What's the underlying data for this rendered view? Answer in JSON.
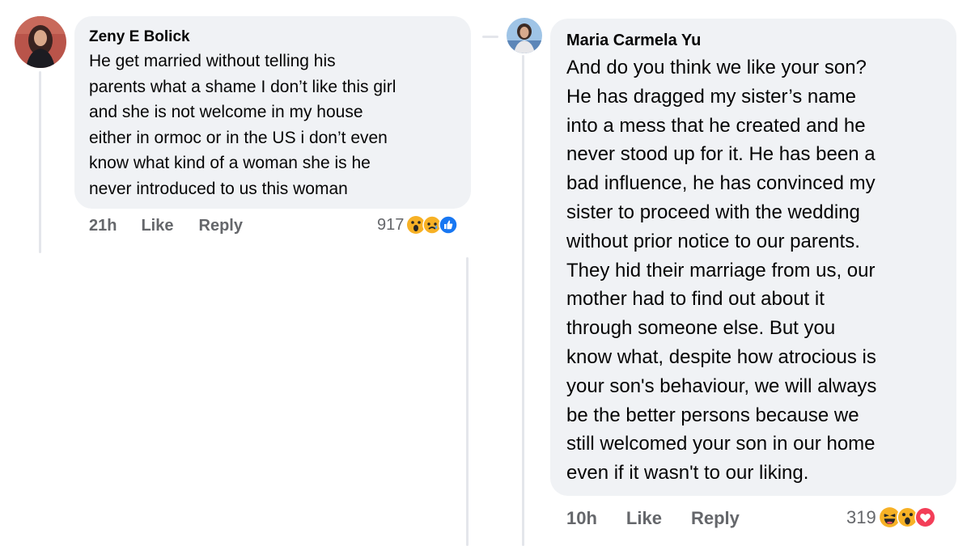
{
  "comments": [
    {
      "author": "Zeny E Bolick",
      "text": "He get married without telling his\nparents what a shame I don’t like this girl\nand she is not welcome in my house\neither in ormoc or in the US i don’t even\nknow what kind of a woman she is he\nnever introduced to us this woman",
      "time": "21h",
      "like_label": "Like",
      "reply_label": "Reply",
      "reaction_count": "917",
      "reactions": [
        "wow-icon",
        "sad-icon",
        "like-icon"
      ]
    },
    {
      "author": "Maria Carmela Yu",
      "text": "And do you think we like your son?\nHe has dragged my sister’s name\ninto a mess that he created and he\nnever stood up for it. He has been a\nbad influence, he has convinced my\nsister to proceed with the wedding\nwithout prior notice to our parents.\nThey hid their marriage from us, our\nmother had to find out about it\nthrough someone else. But you\nknow what, despite how atrocious is\nyour son's behaviour, we will always\nbe the better persons because we\nstill welcomed your son in our home\neven if it wasn't to our liking.",
      "time": "10h",
      "like_label": "Like",
      "reply_label": "Reply",
      "reaction_count": "319",
      "reactions": [
        "haha-icon",
        "wow-icon",
        "love-icon"
      ]
    }
  ],
  "colors": {
    "bubble": "#f0f2f5",
    "text": "#050505",
    "meta": "#65676b",
    "like_blue": "#1877f2",
    "love_red": "#f33e58",
    "emoji_yellow": "#f7b125"
  }
}
